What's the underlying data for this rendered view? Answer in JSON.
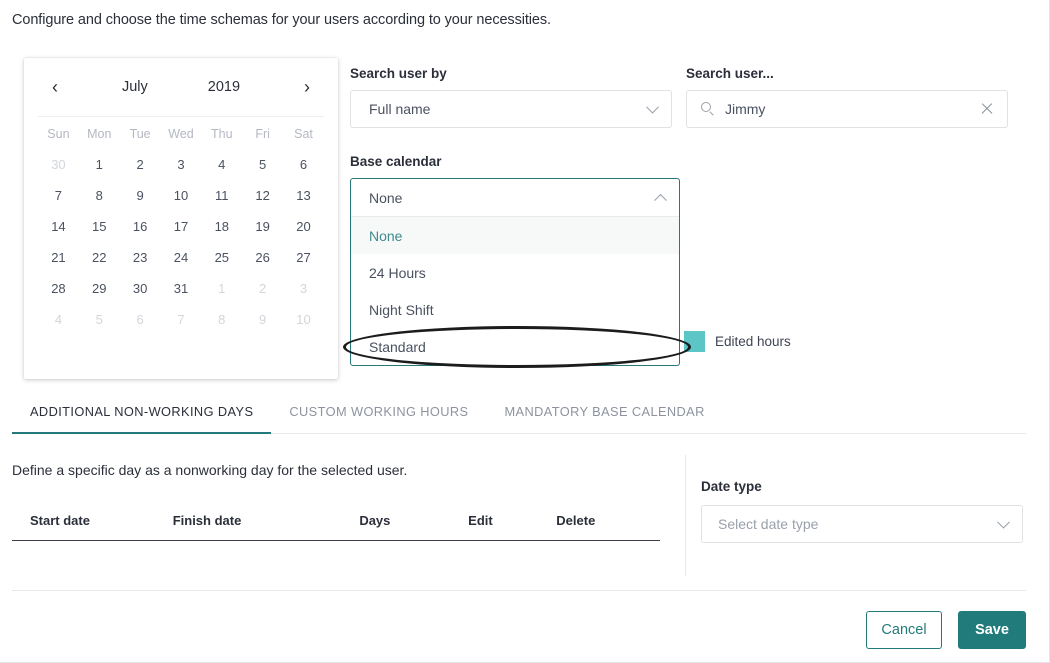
{
  "intro": "Configure and choose the time schemas for your users according to your necessities.",
  "calendar": {
    "prev_icon": "chevron-left-icon",
    "next_icon": "chevron-right-icon",
    "month": "July",
    "year": "2019",
    "weekdays": [
      "Sun",
      "Mon",
      "Tue",
      "Wed",
      "Thu",
      "Fri",
      "Sat"
    ],
    "weeks": [
      [
        {
          "d": "30",
          "muted": true
        },
        {
          "d": "1"
        },
        {
          "d": "2"
        },
        {
          "d": "3"
        },
        {
          "d": "4"
        },
        {
          "d": "5"
        },
        {
          "d": "6"
        }
      ],
      [
        {
          "d": "7"
        },
        {
          "d": "8"
        },
        {
          "d": "9"
        },
        {
          "d": "10"
        },
        {
          "d": "11"
        },
        {
          "d": "12"
        },
        {
          "d": "13"
        }
      ],
      [
        {
          "d": "14"
        },
        {
          "d": "15"
        },
        {
          "d": "16"
        },
        {
          "d": "17"
        },
        {
          "d": "18"
        },
        {
          "d": "19"
        },
        {
          "d": "20"
        }
      ],
      [
        {
          "d": "21"
        },
        {
          "d": "22"
        },
        {
          "d": "23"
        },
        {
          "d": "24"
        },
        {
          "d": "25"
        },
        {
          "d": "26"
        },
        {
          "d": "27"
        }
      ],
      [
        {
          "d": "28"
        },
        {
          "d": "29"
        },
        {
          "d": "30"
        },
        {
          "d": "31"
        },
        {
          "d": "1",
          "muted": true
        },
        {
          "d": "2",
          "muted": true
        },
        {
          "d": "3",
          "muted": true
        }
      ],
      [
        {
          "d": "4",
          "muted": true
        },
        {
          "d": "5",
          "muted": true
        },
        {
          "d": "6",
          "muted": true
        },
        {
          "d": "7",
          "muted": true
        },
        {
          "d": "8",
          "muted": true
        },
        {
          "d": "9",
          "muted": true
        },
        {
          "d": "10",
          "muted": true
        }
      ]
    ]
  },
  "search_by": {
    "label": "Search user by",
    "value": "Full name",
    "options": [
      "Full name"
    ]
  },
  "search_user": {
    "label": "Search user...",
    "value": "Jimmy",
    "placeholder": "Search user...",
    "search_icon": "search-icon",
    "clear_icon": "close-icon"
  },
  "base_calendar": {
    "label": "Base calendar",
    "value": "None",
    "expanded": true,
    "options": [
      {
        "label": "None",
        "selected": true
      },
      {
        "label": "24 Hours",
        "selected": false
      },
      {
        "label": "Night Shift",
        "selected": false
      },
      {
        "label": "Standard",
        "selected": false
      }
    ]
  },
  "legend": {
    "label": "Edited hours",
    "color": "#5cc6c6"
  },
  "tabs": [
    {
      "label": "ADDITIONAL NON-WORKING DAYS",
      "active": true
    },
    {
      "label": "CUSTOM WORKING HOURS",
      "active": false
    },
    {
      "label": "MANDATORY BASE CALENDAR",
      "active": false
    }
  ],
  "panel": {
    "description": "Define a specific day as a nonworking day for the selected user.",
    "table_headers": [
      "Start date",
      "Finish date",
      "Days",
      "Edit",
      "Delete"
    ],
    "rows": []
  },
  "date_type": {
    "label": "Date type",
    "placeholder": "Select date type",
    "value": "Select date type"
  },
  "footer": {
    "cancel_label": "Cancel",
    "save_label": "Save"
  },
  "colors": {
    "accent_teal": "#227b7b",
    "legend_teal": "#5cc6c6",
    "annotation": "#1c1c1c"
  }
}
